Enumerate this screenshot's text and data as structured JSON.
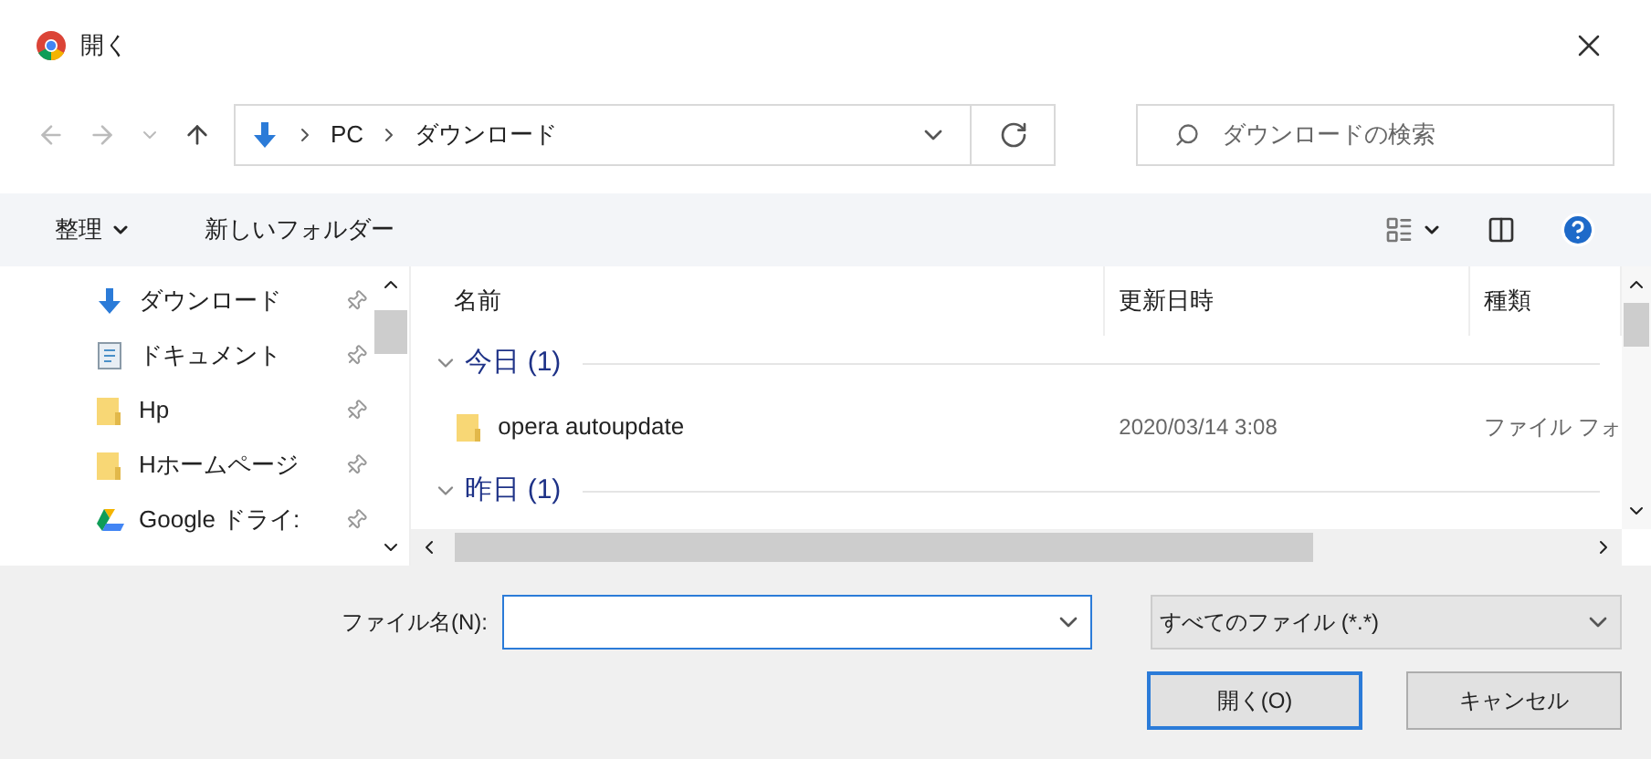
{
  "window": {
    "title": "開く"
  },
  "address": {
    "path": [
      "PC",
      "ダウンロード"
    ]
  },
  "search": {
    "placeholder": "ダウンロードの検索"
  },
  "toolbar": {
    "organize": "整理",
    "new_folder": "新しいフォルダー"
  },
  "sidebar": {
    "items": [
      {
        "label": "ダウンロード",
        "kind": "download"
      },
      {
        "label": "ドキュメント",
        "kind": "document"
      },
      {
        "label": "Hp",
        "kind": "folder"
      },
      {
        "label": "Hホームページ",
        "kind": "folder"
      },
      {
        "label": "Google ドライ:",
        "kind": "drive"
      }
    ]
  },
  "table": {
    "columns": [
      "名前",
      "更新日時",
      "種類"
    ],
    "groups": [
      {
        "label": "今日 (1)",
        "expanded": true,
        "rows": [
          {
            "name": "opera autoupdate",
            "date": "2020/03/14 3:08",
            "type": "ファイル フォ"
          }
        ]
      },
      {
        "label": "昨日 (1)",
        "expanded": true
      }
    ]
  },
  "filename": {
    "label": "ファイル名(N):"
  },
  "filter": {
    "value": "すべてのファイル (*.*)"
  },
  "buttons": [
    {
      "label": "開く(O)",
      "kind": "primary"
    },
    {
      "label": "キャンセル",
      "kind": "secondary"
    }
  ]
}
